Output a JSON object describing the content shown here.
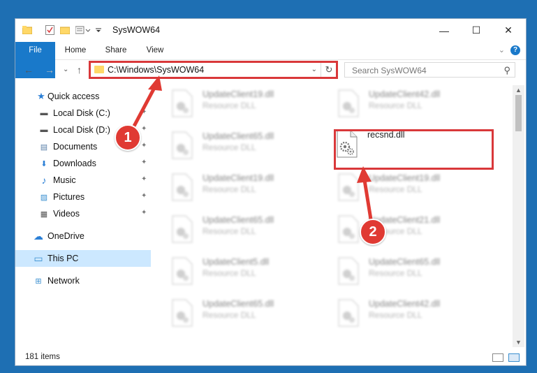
{
  "window": {
    "title": "SysWOW64",
    "minimize_glyph": "—",
    "maximize_glyph": "☐",
    "close_glyph": "✕"
  },
  "ribbon": {
    "tabs": [
      "File",
      "Home",
      "Share",
      "View"
    ],
    "help_glyph": "?",
    "collapse_glyph": "⌄"
  },
  "nav_arrows": {
    "back": "←",
    "forward": "→",
    "recent": "⌄",
    "up": "↑"
  },
  "address": {
    "path": "C:\\Windows\\SysWOW64",
    "dropdown_glyph": "⌄",
    "refresh_glyph": "↻"
  },
  "search": {
    "placeholder": "Search SysWOW64",
    "icon_glyph": "⚲"
  },
  "sidebar": {
    "items": [
      {
        "label": "Quick access",
        "icon": "star-icon",
        "glyph": "★",
        "color": "#2b7fd6",
        "pinned": false
      },
      {
        "label": "Local Disk (C:)",
        "icon": "drive-icon",
        "glyph": "▬",
        "color": "#555555",
        "pinned": true
      },
      {
        "label": "Local Disk (D:)",
        "icon": "drive-icon",
        "glyph": "▬",
        "color": "#555555",
        "pinned": true
      },
      {
        "label": "Documents",
        "icon": "documents-icon",
        "glyph": "▤",
        "color": "#5a7fa8",
        "pinned": true
      },
      {
        "label": "Downloads",
        "icon": "download-icon",
        "glyph": "⬇",
        "color": "#2b7fd6",
        "pinned": true
      },
      {
        "label": "Music",
        "icon": "music-icon",
        "glyph": "♪",
        "color": "#2b7fd6",
        "pinned": true
      },
      {
        "label": "Pictures",
        "icon": "pictures-icon",
        "glyph": "▨",
        "color": "#3a8fd0",
        "pinned": true
      },
      {
        "label": "Videos",
        "icon": "videos-icon",
        "glyph": "▦",
        "color": "#555555",
        "pinned": true
      },
      {
        "label": "OneDrive",
        "icon": "cloud-icon",
        "glyph": "☁",
        "color": "#2b7fd6",
        "pinned": false
      },
      {
        "label": "This PC",
        "icon": "computer-icon",
        "glyph": "▭",
        "color": "#3a8fd0",
        "pinned": false
      },
      {
        "label": "Network",
        "icon": "network-icon",
        "glyph": "⊞",
        "color": "#3a8fd0",
        "pinned": false
      }
    ],
    "pin_glyph": "✦"
  },
  "files": {
    "left": [
      {
        "name": "UpdateClient19.dll",
        "type": "Resource DLL"
      },
      {
        "name": "UpdateClient65.dll",
        "type": "Resource DLL"
      },
      {
        "name": "UpdateClient19.dll",
        "type": "Resource DLL"
      },
      {
        "name": "UpdateClient65.dll",
        "type": "Resource DLL"
      },
      {
        "name": "UpdateClient5.dll",
        "type": "Resource DLL"
      },
      {
        "name": "UpdateClient65.dll",
        "type": "Resource DLL"
      }
    ],
    "right": [
      {
        "name": "UpdateClient42.dll",
        "type": "Resource DLL"
      },
      {
        "name": "recsnd.dll",
        "type": "",
        "highlighted": true
      },
      {
        "name": "UpdateClient19.dll",
        "type": "Resource DLL"
      },
      {
        "name": "UpdateClient21.dll",
        "type": "Resource DLL"
      },
      {
        "name": "UpdateClient65.dll",
        "type": "Resource DLL"
      },
      {
        "name": "UpdateClient42.dll",
        "type": "Resource DLL"
      }
    ]
  },
  "status": {
    "item_count": "181 items"
  },
  "annotations": {
    "step1": "1",
    "step2": "2",
    "color": "#e03a33"
  }
}
